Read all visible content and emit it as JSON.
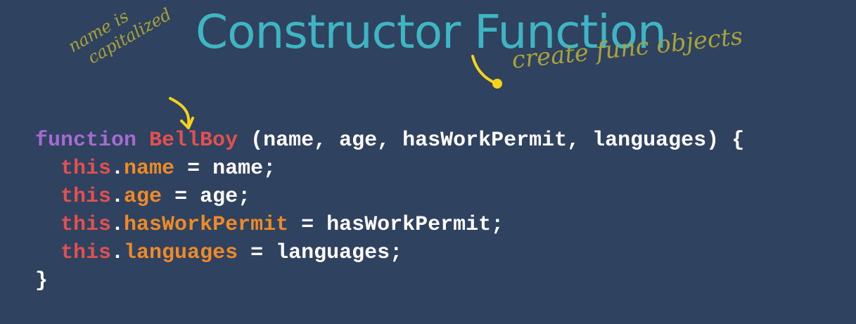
{
  "slide": {
    "title": "Constructor Function",
    "annotations": {
      "name_note_line1": "name is",
      "name_note_line2": "capitalized",
      "create_note": "create func objects"
    },
    "colors": {
      "background": "#2f4260",
      "title": "#3fb5c3",
      "handwriting": "#a7a239",
      "pointer": "#f5d31a",
      "keyword": "#a66bd3",
      "function_name": "#e2504f",
      "this": "#e2504f",
      "property": "#ee8a27",
      "text": "#ffffff"
    }
  },
  "code": {
    "line1": {
      "keyword": "function",
      "name": "BellBoy",
      "rest": " (name, age, hasWorkPermit, languages) {"
    },
    "line2": {
      "indent": "  ",
      "this": "this",
      "dot": ".",
      "prop": "name",
      "rest": " = name;"
    },
    "line3": {
      "indent": "  ",
      "this": "this",
      "dot": ".",
      "prop": "age",
      "rest": " = age;"
    },
    "line4": {
      "indent": "  ",
      "this": "this",
      "dot": ".",
      "prop": "hasWorkPermit",
      "rest": " = hasWorkPermit;"
    },
    "line5": {
      "indent": "  ",
      "this": "this",
      "dot": ".",
      "prop": "languages",
      "rest": " = languages;"
    },
    "line6": {
      "brace": "}"
    }
  }
}
